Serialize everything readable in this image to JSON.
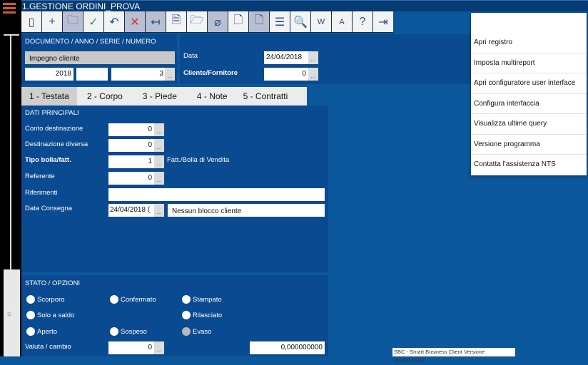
{
  "window": {
    "title": "1.GESTIONE ORDINI_PROVA"
  },
  "toolbar": [
    "panel-icon",
    "plus-icon",
    "folder-open-icon",
    "check-icon",
    "undo-icon",
    "delete-icon",
    "revert-icon",
    "document-new-icon",
    "folder-add-icon",
    "attach-icon",
    "document-icon",
    "document-alt-icon",
    "list-icon",
    "preview-icon",
    "word-icon",
    "pdf-icon",
    "help-icon",
    "exit-icon"
  ],
  "documento": {
    "heading": "DOCUMENTO / ANNO / SERIE / NUMERO",
    "tipo": "Impegno cliente",
    "anno": "2018",
    "serie": "",
    "numero": "3",
    "dots": "..."
  },
  "header": {
    "data_label": "Data",
    "data_value": "24/04/2018",
    "cliente_label": "Cliente/Fornitore",
    "cliente_value": "0"
  },
  "tabs": [
    "1 - Testata",
    "2 - Corpo",
    "3 - Piede",
    "4 - Note",
    "5 - Contratti"
  ],
  "dati": {
    "heading": "DATI PRINCIPALI",
    "conto_label": "Conto destinazione",
    "conto_value": "0",
    "destinazione_label": "Destinazione diversa",
    "destinazione_value": "0",
    "tipo_label": "Tipo bolla/fatt.",
    "tipo_value": "1",
    "tipo_desc": "Fatt./Bolla di Vendita",
    "referente_label": "Referente",
    "referente_value": "0",
    "riferimenti_label": "Riferimenti",
    "riferimenti_value": "",
    "consegna_label": "Data Consegna",
    "consegna_value": "24/04/2018 (",
    "blocco": "Nessun blocco cliente"
  },
  "stato": {
    "heading": "STATO / OPZIONI",
    "options": [
      "Scorporo",
      "Confermato",
      "Stampato",
      "Solo a saldo",
      "Rilasciato",
      "Aperto",
      "Sospeso",
      "Evaso"
    ],
    "valuta_label": "Valuta / cambio",
    "valuta_value": "0",
    "cambio_value": "0,000000000"
  },
  "menu": [
    "Apri registro",
    "Imposta multireport",
    "Apri configuratore user interface",
    "Configura interfaccia",
    "Visualizza ultime query",
    "Versione programma",
    "Contatta l'assistenza NTS"
  ],
  "status": "SBC - Smart Business Client  Versione 2015.0.0.231"
}
